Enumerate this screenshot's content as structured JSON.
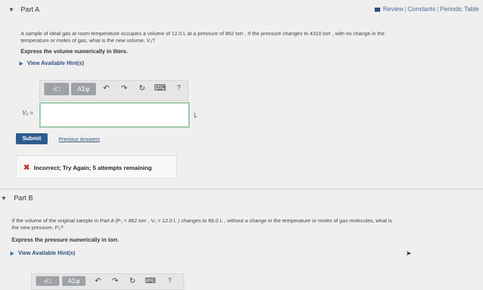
{
  "part_a": {
    "title": "Part A",
    "links": [
      "Review",
      "Constants",
      "Periodic Table"
    ],
    "question_line1": "A sample of ideal gas at room temperature occupies a volume of 12.0 L at a pressure of 862 torr . If the pressure changes to 4310 torr , with no change in the",
    "question_line2": "temperature or moles of gas, what is the new volume, V₂?",
    "instruction": "Express the volume numerically in liters.",
    "hint_label": "View Available Hint(s)",
    "toolbar": {
      "sqrt_label": "√□",
      "greek_label": "AΣφ",
      "undo": "↶",
      "redo": "↷",
      "reset": "↻",
      "keyboard": "⌨",
      "help": "?"
    },
    "answer_label": "V₂ =",
    "answer_value": "",
    "unit": "L",
    "submit_label": "Submit",
    "previous_label": "Previous Answers",
    "feedback": "Incorrect; Try Again; 5 attempts remaining"
  },
  "part_b": {
    "title": "Part B",
    "question_line1": "If the volume of the original sample in Part A (P₁ = 862 torr , V₁ = 12.0 L ) changes to 68.0 L , without a change in the temperature or moles of gas molecules, what is",
    "question_line2": "the new pressure, P₂?",
    "instruction": "Express the pressure numerically in torr.",
    "hint_label": "View Available Hint(s)",
    "toolbar": {
      "sqrt_label": "√□",
      "greek_label": "AΣφ"
    }
  }
}
